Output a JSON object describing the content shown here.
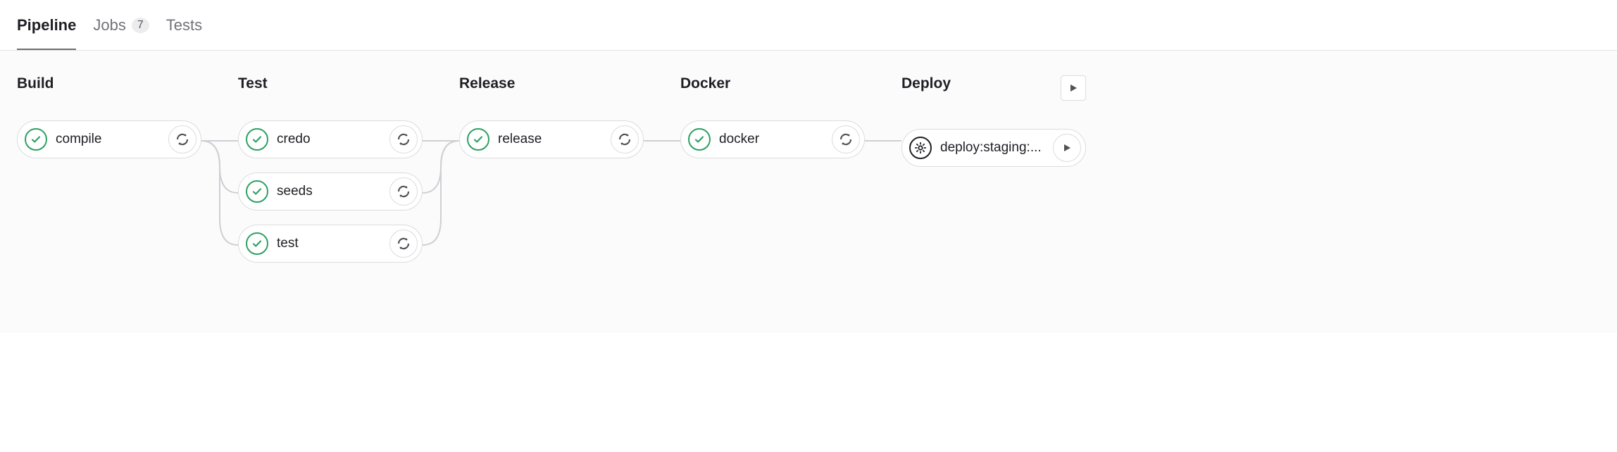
{
  "tabs": [
    {
      "label": "Pipeline",
      "active": true
    },
    {
      "label": "Jobs",
      "badge": "7",
      "active": false
    },
    {
      "label": "Tests",
      "active": false
    }
  ],
  "stages": [
    {
      "title": "Build",
      "jobs": [
        {
          "name": "compile",
          "status": "success",
          "action": "retry"
        }
      ]
    },
    {
      "title": "Test",
      "jobs": [
        {
          "name": "credo",
          "status": "success",
          "action": "retry"
        },
        {
          "name": "seeds",
          "status": "success",
          "action": "retry"
        },
        {
          "name": "test",
          "status": "success",
          "action": "retry"
        }
      ]
    },
    {
      "title": "Release",
      "jobs": [
        {
          "name": "release",
          "status": "success",
          "action": "retry"
        }
      ]
    },
    {
      "title": "Docker",
      "jobs": [
        {
          "name": "docker",
          "status": "success",
          "action": "retry"
        }
      ]
    },
    {
      "title": "Deploy",
      "play_all": true,
      "jobs": [
        {
          "name": "deploy:staging:...",
          "status": "manual",
          "action": "play"
        }
      ]
    }
  ]
}
